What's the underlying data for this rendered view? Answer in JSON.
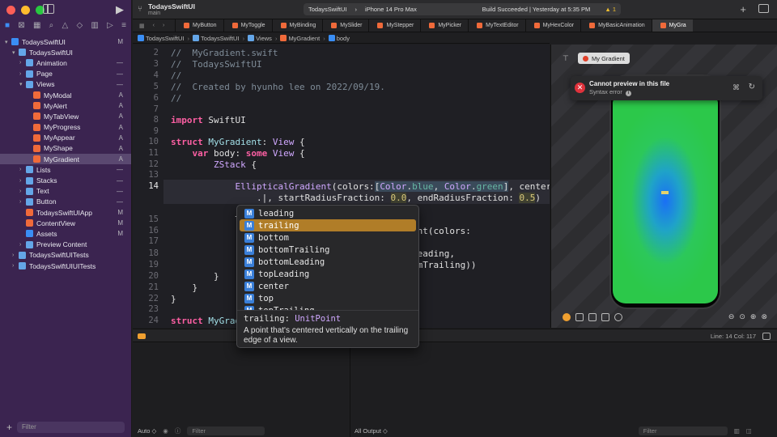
{
  "colors": {
    "sidebar_bg": "#3b2450",
    "selected_row": "#5a4870",
    "autocomplete_selected": "#b07d28",
    "accent_blue": "#3a8ef5",
    "error_red": "#e0323c"
  },
  "toolbar": {
    "project": "TodaysSwiftUI",
    "branch": "main",
    "scheme": "TodaysSwiftUI",
    "device": "iPhone 14 Pro Max",
    "build_status": "Build Succeeded | Yesterday at 5:35 PM",
    "warnings": "1"
  },
  "tabs": [
    "MyButton",
    "MyToggle",
    "MyBinding",
    "MySlider",
    "MyStepper",
    "MyPicker",
    "MyTextEditor",
    "MyHexColor",
    "MyBasicAnimation",
    "MyGra"
  ],
  "breadcrumbs": [
    "TodaysSwiftUI",
    "TodaysSwiftUI",
    "Views",
    "MyGradient",
    "body"
  ],
  "navigator": {
    "rows": [
      {
        "label": "TodaysSwiftUI",
        "badge": "M",
        "indent": 0,
        "kind": "proj",
        "chev": "▾"
      },
      {
        "label": "TodaysSwiftUI",
        "badge": "",
        "indent": 1,
        "kind": "folder",
        "chev": "▾"
      },
      {
        "label": "Animation",
        "badge": "—",
        "indent": 2,
        "kind": "folder",
        "chev": "›"
      },
      {
        "label": "Page",
        "badge": "—",
        "indent": 2,
        "kind": "folder",
        "chev": "›"
      },
      {
        "label": "Views",
        "badge": "—",
        "indent": 2,
        "kind": "folder",
        "chev": "▾"
      },
      {
        "label": "MyModal",
        "badge": "A",
        "indent": 3,
        "kind": "swift",
        "chev": ""
      },
      {
        "label": "MyAlert",
        "badge": "A",
        "indent": 3,
        "kind": "swift",
        "chev": ""
      },
      {
        "label": "MyTabView",
        "badge": "A",
        "indent": 3,
        "kind": "swift",
        "chev": ""
      },
      {
        "label": "MyProgress",
        "badge": "A",
        "indent": 3,
        "kind": "swift",
        "chev": ""
      },
      {
        "label": "MyAppear",
        "badge": "A",
        "indent": 3,
        "kind": "swift",
        "chev": ""
      },
      {
        "label": "MyShape",
        "badge": "A",
        "indent": 3,
        "kind": "swift",
        "chev": ""
      },
      {
        "label": "MyGradient",
        "badge": "A",
        "indent": 3,
        "kind": "swift",
        "chev": "",
        "selected": true
      },
      {
        "label": "Lists",
        "badge": "—",
        "indent": 2,
        "kind": "folder",
        "chev": "›"
      },
      {
        "label": "Stacks",
        "badge": "—",
        "indent": 2,
        "kind": "folder",
        "chev": "›"
      },
      {
        "label": "Text",
        "badge": "—",
        "indent": 2,
        "kind": "folder",
        "chev": "›"
      },
      {
        "label": "Button",
        "badge": "—",
        "indent": 2,
        "kind": "folder",
        "chev": "›"
      },
      {
        "label": "TodaysSwiftUIApp",
        "badge": "M",
        "indent": 2,
        "kind": "swift",
        "chev": ""
      },
      {
        "label": "ContentView",
        "badge": "M",
        "indent": 2,
        "kind": "swift",
        "chev": ""
      },
      {
        "label": "Assets",
        "badge": "M",
        "indent": 2,
        "kind": "assets",
        "chev": ""
      },
      {
        "label": "Preview Content",
        "badge": "",
        "indent": 2,
        "kind": "folder",
        "chev": "›"
      },
      {
        "label": "TodaysSwiftUITests",
        "badge": "",
        "indent": 1,
        "kind": "folder",
        "chev": "›"
      },
      {
        "label": "TodaysSwiftUIUITests",
        "badge": "",
        "indent": 1,
        "kind": "folder",
        "chev": "›"
      }
    ],
    "filter_placeholder": "Filter"
  },
  "editor": {
    "line_numbers": [
      "2",
      "3",
      "4",
      "5",
      "6",
      "7",
      "8",
      "9",
      "10",
      "11",
      "12",
      "13",
      "14",
      "",
      "15",
      "16",
      "17",
      "",
      "18",
      "19",
      "20",
      "21",
      "22",
      "23",
      "24"
    ],
    "current_line": "14"
  },
  "autocomplete": {
    "items": [
      "leading",
      "trailing",
      "bottom",
      "bottomTrailing",
      "bottomLeading",
      "topLeading",
      "center",
      "top",
      "topTrailing"
    ],
    "selected": "trailing",
    "badge": "M",
    "detail_name": "trailing:",
    "detail_type": "UnitPoint",
    "detail_desc": "A point that's centered vertically on the trailing edge of a view."
  },
  "preview": {
    "chip": "My Gradient",
    "error_title": "Cannot preview in this file",
    "error_sub": "Syntax error"
  },
  "status": {
    "position": "Line: 14  Col: 117"
  },
  "debug": {
    "scope": "Auto ◇",
    "filter_placeholder": "Filter",
    "output": "All Output ◇"
  }
}
